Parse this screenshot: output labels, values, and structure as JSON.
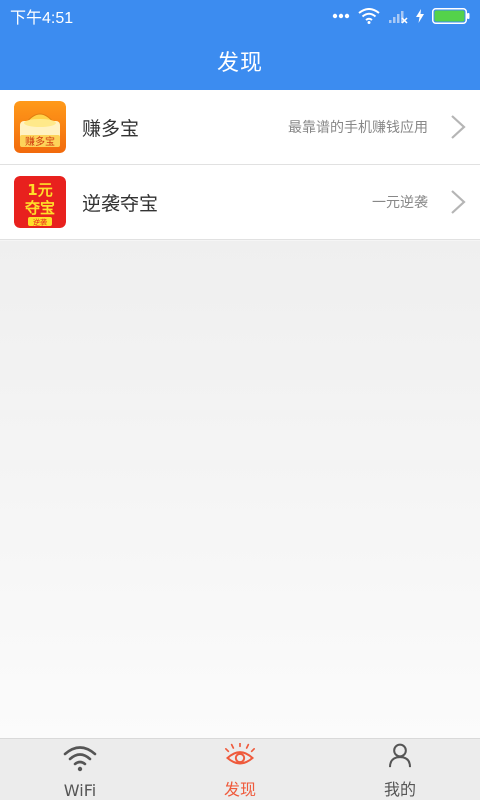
{
  "status_bar": {
    "time": "下午4:51",
    "icons": [
      "more-dots-icon",
      "wifi-icon",
      "signal-icon",
      "charging-icon",
      "battery-icon"
    ]
  },
  "header": {
    "title": "发现"
  },
  "list": {
    "items": [
      {
        "name": "赚多宝",
        "description": "最靠谱的手机赚钱应用",
        "icon": "zhuanduobao-app-icon",
        "icon_text": "赚多宝"
      },
      {
        "name": "逆袭夺宝",
        "description": "一元逆袭",
        "icon": "nixiduobao-app-icon",
        "icon_text_top": "1元",
        "icon_text_mid": "夺宝",
        "icon_text_bottom": "逆袭"
      }
    ]
  },
  "bottom_nav": {
    "items": [
      {
        "label": "WiFi",
        "icon": "wifi-icon",
        "active": false
      },
      {
        "label": "发现",
        "icon": "eye-icon",
        "active": true
      },
      {
        "label": "我的",
        "icon": "user-icon",
        "active": false
      }
    ]
  },
  "colors": {
    "primary": "#3c8cf0",
    "accent": "#ef5a3c",
    "nav_bg": "#ececec"
  }
}
